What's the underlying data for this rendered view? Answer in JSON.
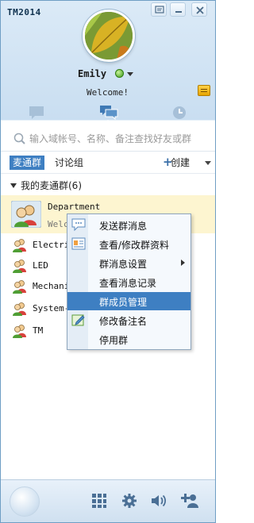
{
  "window": {
    "title": "TM2014"
  },
  "profile": {
    "name": "Emily",
    "status": "online",
    "signature": "Welcome!"
  },
  "main_tabs": [
    {
      "name": "chat",
      "icon": "chat-bubble-icon"
    },
    {
      "name": "groups",
      "icon": "group-chat-icon",
      "active": true
    },
    {
      "name": "recent",
      "icon": "clock-icon"
    }
  ],
  "search": {
    "placeholder": "输入域帐号、名称、备注查找好友或群"
  },
  "subtabs": {
    "active": "麦通群",
    "other": "讨论组",
    "create": "创建"
  },
  "group_section": {
    "label": "我的麦通群(6)"
  },
  "groups": [
    {
      "name": "Department",
      "desc": "Welcome",
      "selected": true
    },
    {
      "name": "Electric"
    },
    {
      "name": "LED"
    },
    {
      "name": "Mechani"
    },
    {
      "name": "System-"
    },
    {
      "name": "TM"
    }
  ],
  "context_menu": {
    "items": [
      {
        "label": "发送群消息",
        "icon": "chat-icon"
      },
      {
        "label": "查看/修改群资料",
        "icon": "profile-card-icon"
      },
      {
        "label": "群消息设置",
        "submenu": true
      },
      {
        "label": "查看消息记录"
      },
      {
        "label": "群成员管理",
        "highlighted": true
      },
      {
        "label": "修改备注名",
        "icon": "edit-icon"
      },
      {
        "label": "停用群"
      }
    ]
  },
  "colors": {
    "accent": "#3e7fc2",
    "selected_row": "#fdf5d0",
    "menu_bg": "#f5f9fd"
  }
}
